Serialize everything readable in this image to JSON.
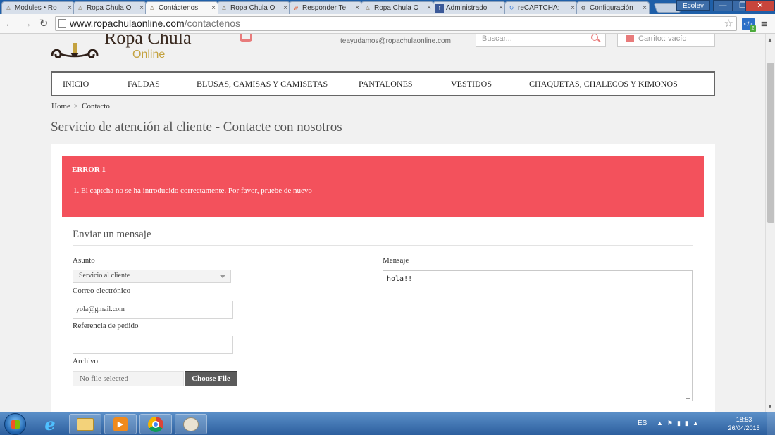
{
  "browser": {
    "tabs": [
      {
        "title": "Modules • Ro",
        "icon": "lamp-icon",
        "active": false
      },
      {
        "title": "Ropa Chula O",
        "icon": "lamp-icon",
        "active": false
      },
      {
        "title": "Contáctenos",
        "icon": "lamp-icon",
        "active": true
      },
      {
        "title": "Ropa Chula O",
        "icon": "lamp-icon",
        "active": false
      },
      {
        "title": "Responder Te",
        "icon": "wattpad-icon",
        "active": false
      },
      {
        "title": "Ropa Chula O",
        "icon": "lamp-icon",
        "active": false
      },
      {
        "title": "Administrado",
        "icon": "facebook-icon",
        "active": false
      },
      {
        "title": "reCAPTCHA: ",
        "icon": "recaptcha-icon",
        "active": false
      },
      {
        "title": "Configuración",
        "icon": "gear-icon",
        "active": false
      }
    ],
    "window_user": "Ecolev",
    "url": {
      "domain": "www.ropachulaonline.com",
      "path": "/contactenos"
    },
    "extension_badge": "2"
  },
  "site": {
    "logo": {
      "name": "Ropa Chula",
      "sub": "Online"
    },
    "email": "teayudamos@ropachulaonline.com",
    "search_placeholder": "Buscar...",
    "cart_label": "Carrito:: vacío"
  },
  "menu": [
    "INICIO",
    "FALDAS",
    "BLUSAS, CAMISAS Y CAMISETAS",
    "PANTALONES",
    "VESTIDOS",
    "CHAQUETAS, CHALECOS Y KIMONOS"
  ],
  "breadcrumb": {
    "home": "Home",
    "separator": ">",
    "current": "Contacto"
  },
  "page_title": "Servicio de atención al cliente - Contacte con nosotros",
  "error": {
    "title": "ERROR 1",
    "message": "1.  El captcha no se ha introducido correctamente. Por favor, pruebe de nuevo",
    "color": "#f3515c"
  },
  "form": {
    "heading": "Enviar un mensaje",
    "subject_label": "Asunto",
    "subject_value": "Servicio al cliente",
    "email_label": "Correo electrónico",
    "email_value": "yola@gmail.com",
    "order_label": "Referencia de pedido",
    "order_value": "",
    "file_label": "Archivo",
    "file_status": "No file selected",
    "file_button": "Choose File",
    "message_label": "Mensaje",
    "message_value": "hola!!"
  },
  "taskbar": {
    "language": "ES",
    "time": "18:53",
    "date": "26/04/2015"
  }
}
